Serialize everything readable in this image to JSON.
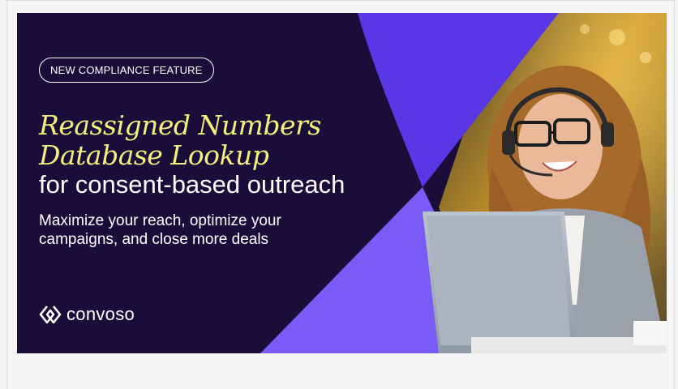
{
  "banner": {
    "badge": "NEW COMPLIANCE FEATURE",
    "headline_line1": "Reassigned Numbers",
    "headline_line2": "Database Lookup",
    "subhead": "for consent-based outreach",
    "tagline_line1": "Maximize your reach, optimize your",
    "tagline_line2": "campaigns, and close more deals",
    "logo_text": "convoso"
  },
  "colors": {
    "background_dark": "#1a0d3a",
    "accent_purple": "#5a37e6",
    "accent_violet": "#7b5bf5",
    "headline_yellow": "#f4ee7c"
  },
  "icons": [
    "convoso-logo-icon"
  ]
}
